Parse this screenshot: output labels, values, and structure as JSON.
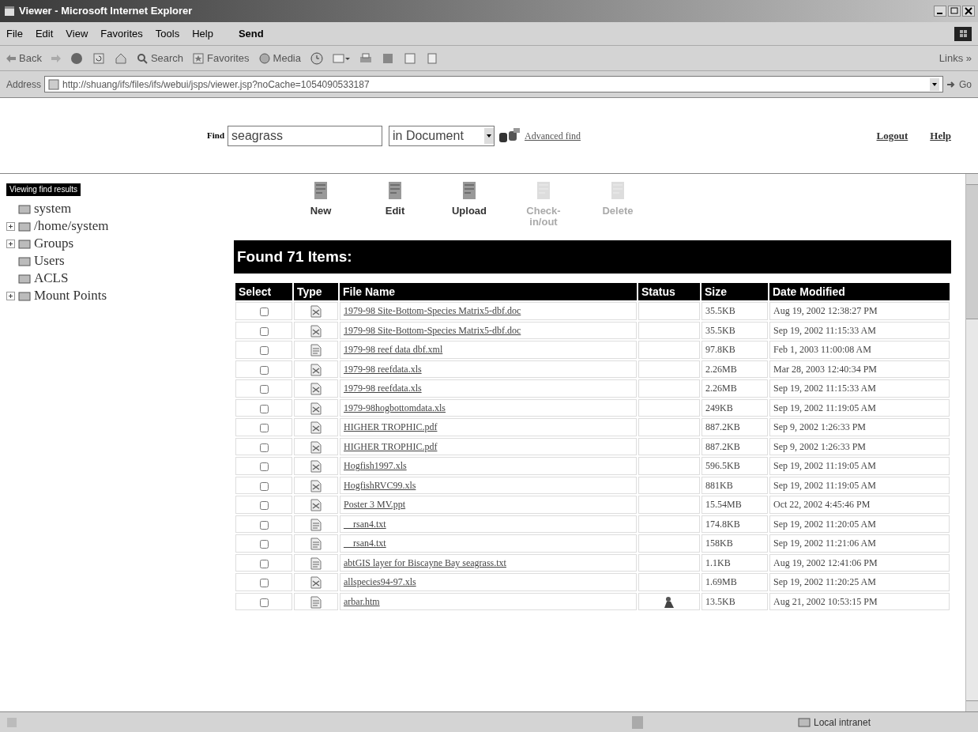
{
  "window": {
    "title": "Viewer - Microsoft Internet Explorer"
  },
  "menu": [
    "File",
    "Edit",
    "View",
    "Favorites",
    "Tools",
    "Help",
    "Send"
  ],
  "toolbar": {
    "back": "Back",
    "search": "Search",
    "favorites": "Favorites",
    "media": "Media",
    "links": "Links »"
  },
  "address": {
    "label": "Address",
    "url": "http://shuang/ifs/files/ifs/webui/jsps/viewer.jsp?noCache=1054090533187",
    "go": "Go"
  },
  "header": {
    "find_label": "Find",
    "find_value": "seagrass",
    "scope": "in Document",
    "advanced": "Advanced find",
    "logout": "Logout",
    "help": "Help"
  },
  "sidebar": {
    "badge": "Viewing find results",
    "items": [
      {
        "label": "system",
        "expandable": false
      },
      {
        "label": "/home/system",
        "expandable": true
      },
      {
        "label": "Groups",
        "expandable": true
      },
      {
        "label": "Users",
        "expandable": false
      },
      {
        "label": "ACLS",
        "expandable": false
      },
      {
        "label": "Mount Points",
        "expandable": true
      }
    ]
  },
  "actions": [
    {
      "label": "New",
      "disabled": false
    },
    {
      "label": "Edit",
      "disabled": false
    },
    {
      "label": "Upload",
      "disabled": false
    },
    {
      "label": "Check-in/out",
      "disabled": true
    },
    {
      "label": "Delete",
      "disabled": true
    }
  ],
  "results": {
    "title": "Found 71 Items:",
    "columns": [
      "Select",
      "Type",
      "File Name",
      "Status",
      "Size",
      "Date Modified"
    ],
    "rows": [
      {
        "selected": false,
        "kind": "document",
        "name": "1979-98 Site-Bottom-Species Matrix5-dbf.doc",
        "locked": false,
        "size": "35.5KB",
        "date": "Aug 19, 2002 12:38:27 PM"
      },
      {
        "selected": false,
        "kind": "document",
        "name": "1979-98 Site-Bottom-Species Matrix5-dbf.doc",
        "locked": false,
        "size": "35.5KB",
        "date": "Sep 19, 2002 11:15:33 AM"
      },
      {
        "selected": false,
        "kind": "text",
        "name": "1979-98 reef data dbf.xml",
        "locked": false,
        "size": "97.8KB",
        "date": "Feb 1, 2003 11:00:08 AM"
      },
      {
        "selected": false,
        "kind": "document",
        "name": "1979-98 reefdata.xls",
        "locked": false,
        "size": "2.26MB",
        "date": "Mar 28, 2003 12:40:34 PM"
      },
      {
        "selected": false,
        "kind": "document",
        "name": "1979-98 reefdata.xls",
        "locked": false,
        "size": "2.26MB",
        "date": "Sep 19, 2002 11:15:33 AM"
      },
      {
        "selected": false,
        "kind": "document",
        "name": "1979-98hogbottomdata.xls",
        "locked": false,
        "size": "249KB",
        "date": "Sep 19, 2002 11:19:05 AM"
      },
      {
        "selected": false,
        "kind": "document",
        "name": "HIGHER TROPHIC.pdf",
        "locked": false,
        "size": "887.2KB",
        "date": "Sep 9, 2002 1:26:33 PM"
      },
      {
        "selected": false,
        "kind": "document",
        "name": "HIGHER TROPHIC.pdf",
        "locked": false,
        "size": "887.2KB",
        "date": "Sep 9, 2002 1:26:33 PM"
      },
      {
        "selected": false,
        "kind": "document",
        "name": "Hogfish1997.xls",
        "locked": false,
        "size": "596.5KB",
        "date": "Sep 19, 2002 11:19:05 AM"
      },
      {
        "selected": false,
        "kind": "document",
        "name": "HogfishRVC99.xls",
        "locked": false,
        "size": "881KB",
        "date": "Sep 19, 2002 11:19:05 AM"
      },
      {
        "selected": false,
        "kind": "document",
        "name": "Poster 3 MV.ppt",
        "locked": false,
        "size": "15.54MB",
        "date": "Oct 22, 2002 4:45:46 PM"
      },
      {
        "selected": false,
        "kind": "text",
        "name": "__rsan4.txt",
        "locked": false,
        "size": "174.8KB",
        "date": "Sep 19, 2002 11:20:05 AM"
      },
      {
        "selected": false,
        "kind": "text",
        "name": "__rsan4.txt",
        "locked": false,
        "size": "158KB",
        "date": "Sep 19, 2002 11:21:06 AM"
      },
      {
        "selected": false,
        "kind": "text",
        "name": "abtGIS layer for Biscayne Bay seagrass.txt",
        "locked": false,
        "size": "1.1KB",
        "date": "Aug 19, 2002 12:41:06 PM"
      },
      {
        "selected": false,
        "kind": "document",
        "name": "allspecies94-97.xls",
        "locked": false,
        "size": "1.69MB",
        "date": "Sep 19, 2002 11:20:25 AM"
      },
      {
        "selected": false,
        "kind": "text",
        "name": "arbar.htm",
        "locked": true,
        "size": "13.5KB",
        "date": "Aug 21, 2002 10:53:15 PM"
      }
    ]
  },
  "status_bar": {
    "zone": "Local intranet"
  }
}
